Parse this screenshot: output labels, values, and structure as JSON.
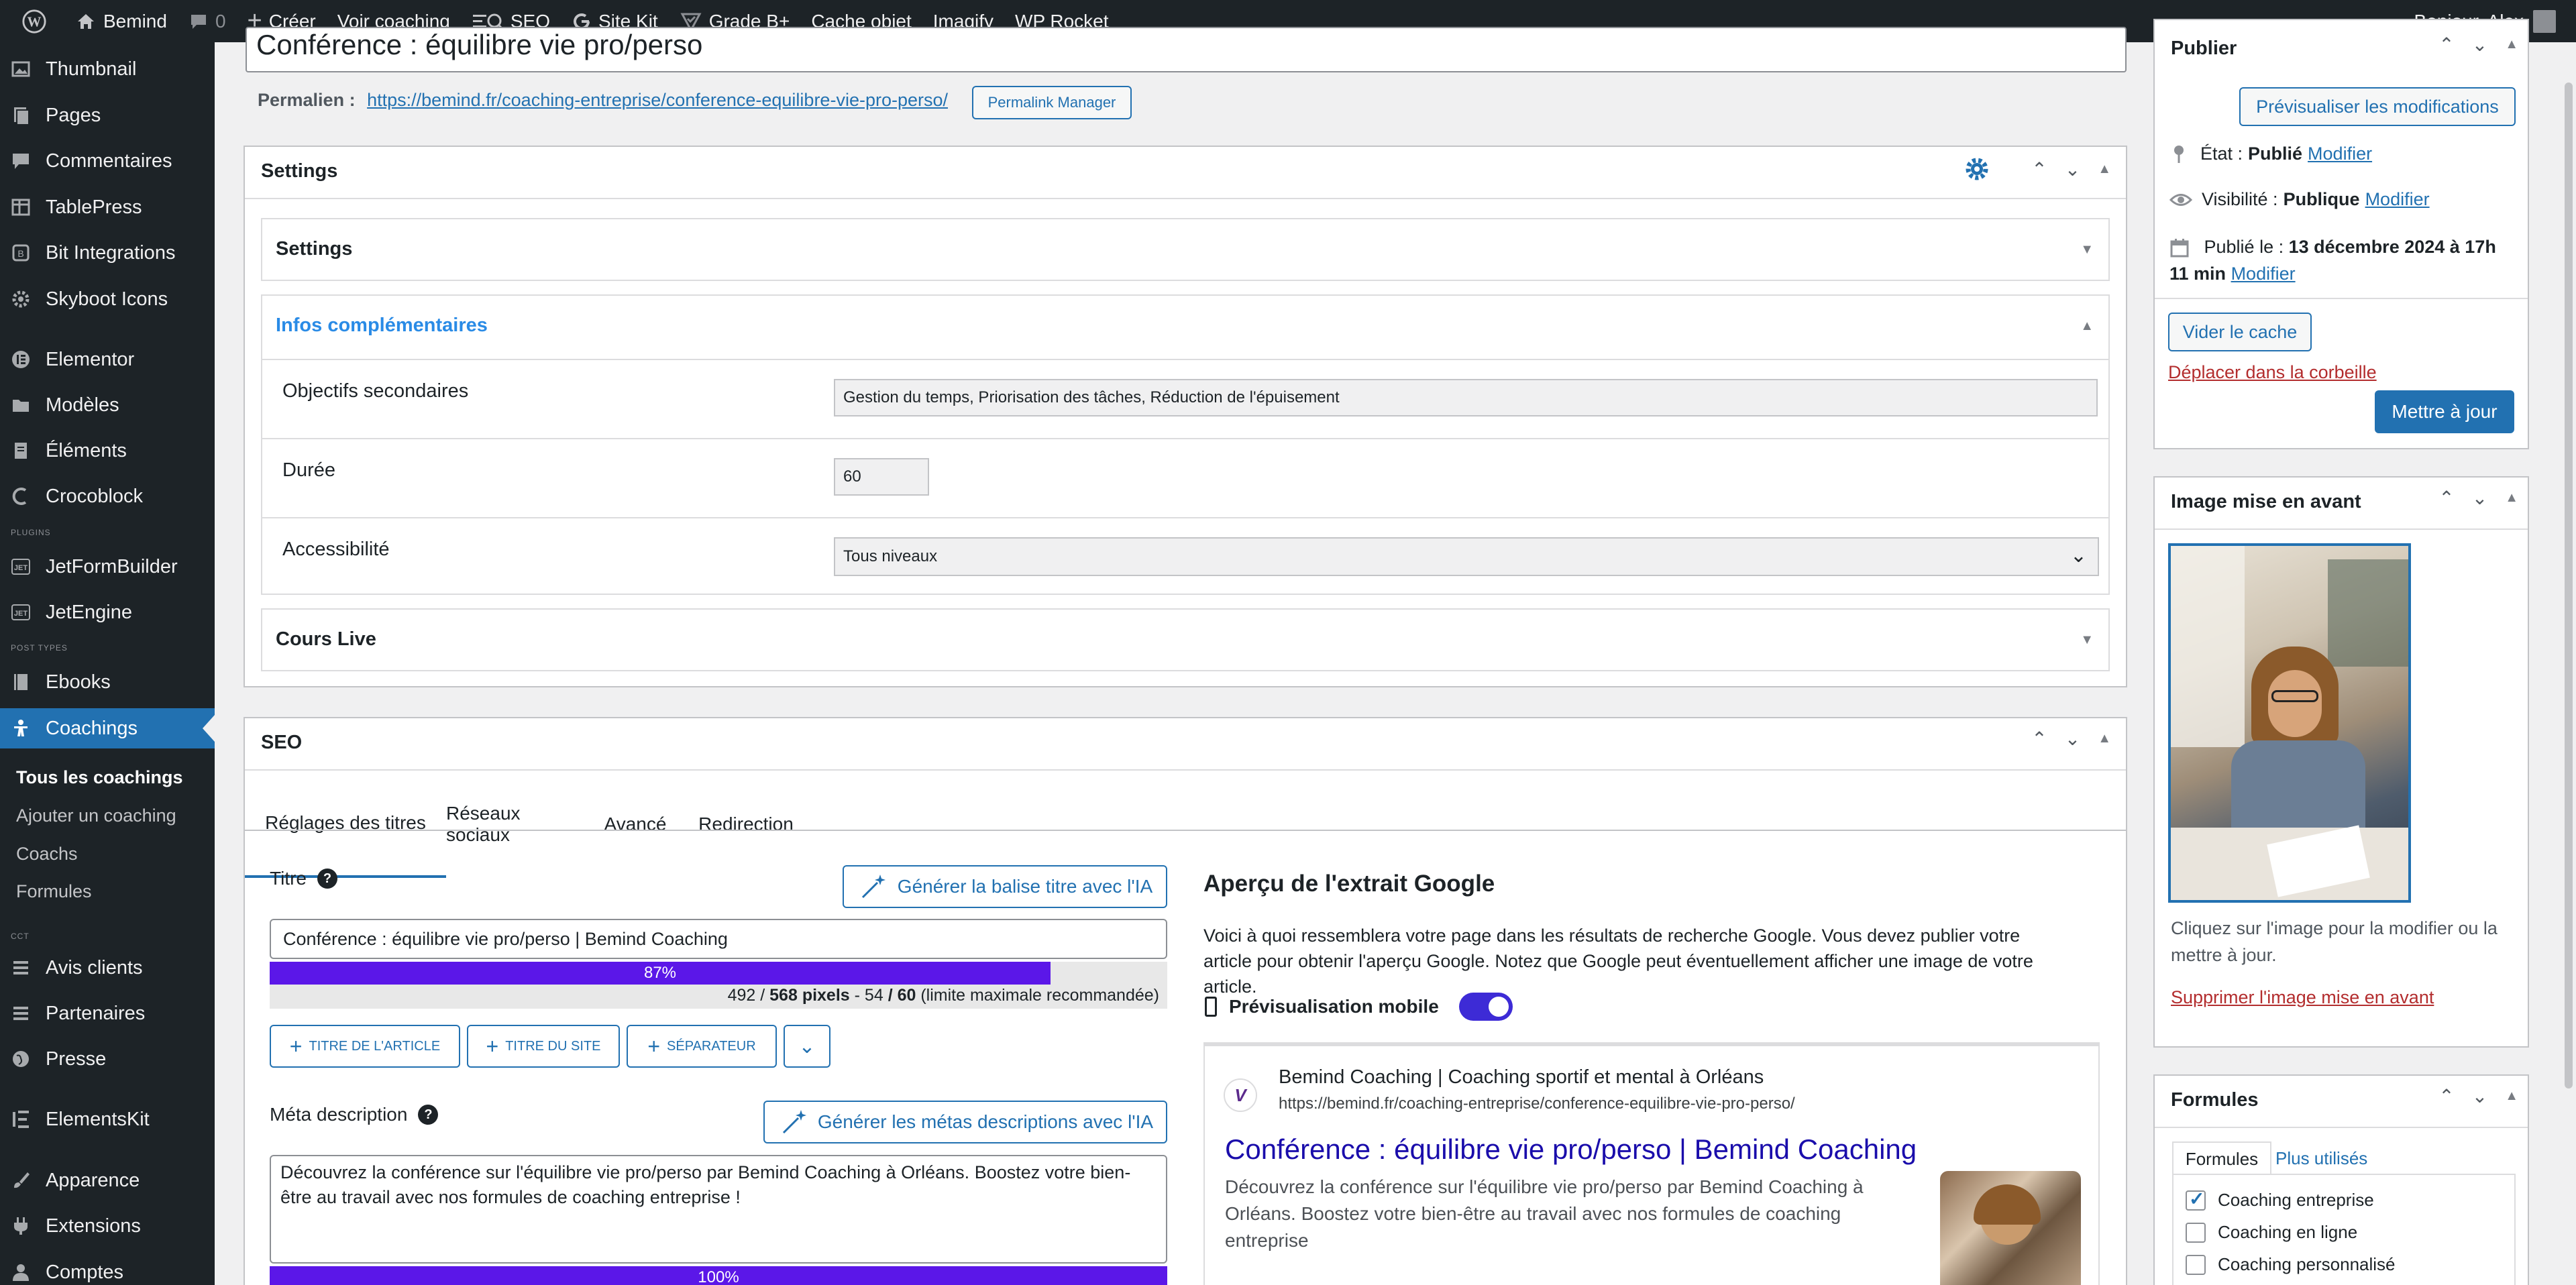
{
  "adminbar": {
    "site": "Bemind",
    "comments": "0",
    "create": "Créer",
    "view": "Voir coaching",
    "seo": "SEO",
    "sitekit": "Site Kit",
    "grade": "Grade B+",
    "cache": "Cache objet",
    "imagify": "Imagify",
    "rocket": "WP Rocket",
    "greeting": "Bonjour, Alex"
  },
  "sidebar": {
    "thumbnail": "Thumbnail",
    "pages": "Pages",
    "comments": "Commentaires",
    "tablepress": "TablePress",
    "bit": "Bit Integrations",
    "skyboot": "Skyboot Icons",
    "elementor": "Elementor",
    "models": "Modèles",
    "elements": "Éléments",
    "crocoblock": "Crocoblock",
    "plugins_sep": "PLUGINS",
    "jetform": "JetFormBuilder",
    "jetengine": "JetEngine",
    "post_types_sep": "POST TYPES",
    "ebooks": "Ebooks",
    "coachings": "Coachings",
    "sub_all": "Tous les coachings",
    "sub_add": "Ajouter un coaching",
    "sub_coachs": "Coachs",
    "sub_formules": "Formules",
    "cct_sep": "CCT",
    "avis": "Avis clients",
    "partenaires": "Partenaires",
    "presse": "Presse",
    "elementskit": "ElementsKit",
    "apparence": "Apparence",
    "extensions": "Extensions",
    "comptes": "Comptes"
  },
  "editor": {
    "title": "Conférence : équilibre vie pro/perso",
    "permalink_label": "Permalien :",
    "permalink_url": "https://bemind.fr/coaching-entreprise/conference-equilibre-vie-pro-perso/",
    "permalink_manager": "Permalink Manager"
  },
  "settings": {
    "heading": "Settings",
    "sub_settings": "Settings",
    "infos": "Infos complémentaires",
    "obj_label": "Objectifs secondaires",
    "obj_value": "Gestion du temps, Priorisation des tâches, Réduction de l'épuisement",
    "duree_label": "Durée",
    "duree_value": "60",
    "access_label": "Accessibilité",
    "access_value": "Tous niveaux",
    "cours_live": "Cours Live"
  },
  "seo": {
    "heading": "SEO",
    "tabs": [
      "Réglages des titres",
      "Réseaux sociaux",
      "Avancé",
      "Redirection"
    ],
    "title_label": "Titre",
    "gen_title_btn": "Générer la balise titre avec l'IA",
    "title_value": "Conférence : équilibre vie pro/perso | Bemind Coaching",
    "title_progress": 0.87,
    "title_progress_label": "87%",
    "pixels_a": "492",
    "pixels_b": "568 pixels",
    "pixels_c": "- 54",
    "pixels_d": "/ 60",
    "pixels_e": "(limite maximale recommandée)",
    "btn_article": "TITRE DE L'ARTICLE",
    "btn_site": "TITRE DU SITE",
    "btn_sep": "SÉPARATEUR",
    "meta_label": "Méta description",
    "gen_meta_btn": "Générer les métas descriptions avec l'IA",
    "meta_value": "Découvrez la conférence sur l'équilibre vie pro/perso par Bemind Coaching à Orléans. Boostez votre bien-être au travail avec nos formules de coaching entreprise !",
    "meta_progress": 1.0,
    "meta_progress_label": "100%",
    "preview_title": "Aperçu de l'extrait Google",
    "preview_text": "Voici à quoi ressemblera votre page dans les résultats de recherche Google. Vous devez publier votre article pour obtenir l'aperçu Google. Notez que Google peut éventuellement afficher une image de votre article.",
    "mobile_label": "Prévisualisation mobile",
    "mobile_on": true,
    "g_site": "Bemind Coaching | Coaching sportif et mental à Orléans",
    "g_url": "https://bemind.fr/coaching-entreprise/conference-equilibre-vie-pro-perso/",
    "g_title": "Conférence : équilibre vie pro/perso | Bemind Coaching",
    "g_desc": "Découvrez la conférence sur l'équilibre vie pro/perso par Bemind Coaching à Orléans. Boostez votre bien-être au travail avec nos formules de coaching entreprise"
  },
  "publish": {
    "heading": "Publier",
    "preview_btn": "Prévisualiser les modifications",
    "status_label": "État :",
    "status_value": "Publié",
    "visibility_label": "Visibilité :",
    "visibility_value": "Publique",
    "published_label": "Publié le :",
    "published_value": "13 décembre 2024 à 17h",
    "published_value2": "11 min",
    "modify": "Modifier",
    "clear_cache": "Vider le cache",
    "trash": "Déplacer dans la corbeille",
    "update": "Mettre à jour"
  },
  "featured": {
    "heading": "Image mise en avant",
    "hint": "Cliquez sur l'image pour la modifier ou la mettre à jour.",
    "remove": "Supprimer l'image mise en avant"
  },
  "formules": {
    "heading": "Formules",
    "tab_all": "Formules",
    "tab_popular": "Plus utilisés",
    "items": [
      {
        "label": "Coaching entreprise",
        "checked": true
      },
      {
        "label": "Coaching en ligne",
        "checked": false
      },
      {
        "label": "Coaching personnalisé",
        "checked": false
      }
    ]
  },
  "colors": {
    "accent": "#2271b1",
    "seo_purple": "#5b17e8",
    "toggle": "#3d2bd6"
  }
}
